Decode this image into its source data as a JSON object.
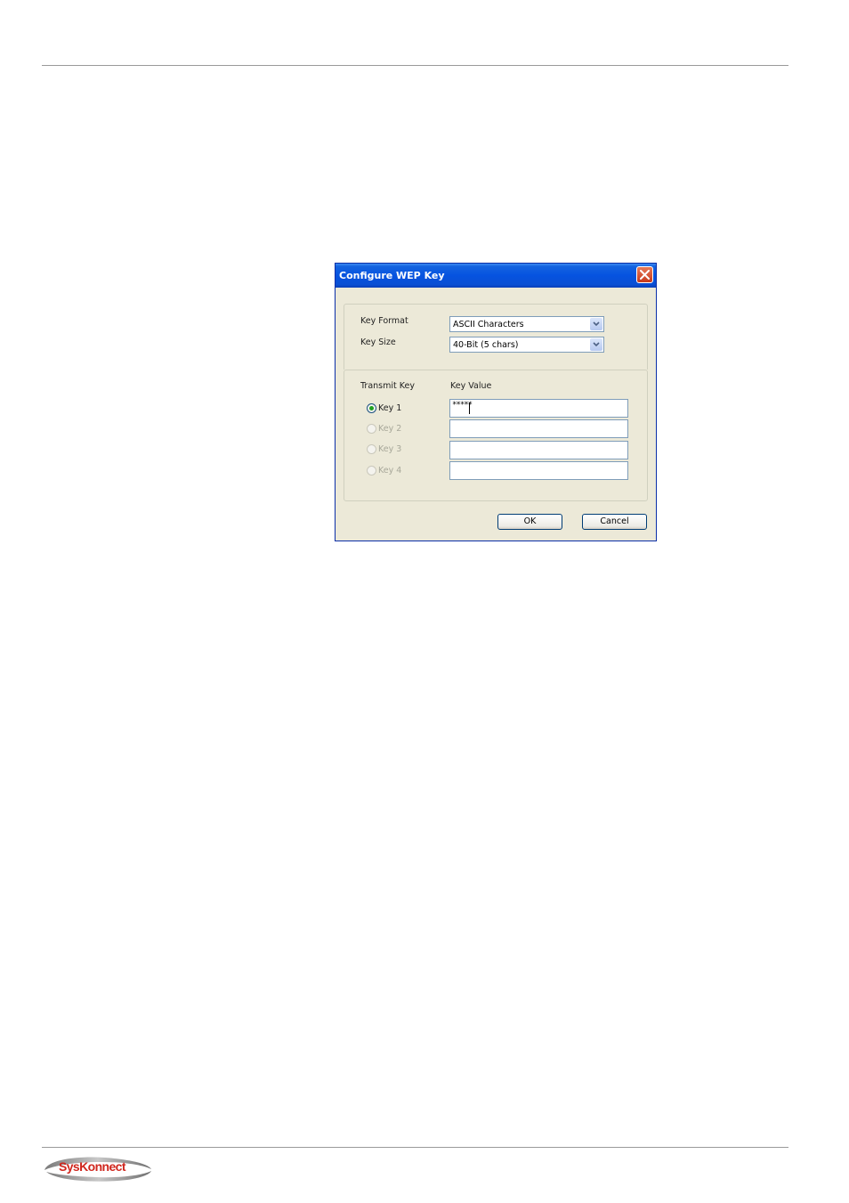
{
  "dialog": {
    "title": "Configure WEP Key",
    "key_format": {
      "label": "Key Format",
      "value": "ASCII Characters"
    },
    "key_size": {
      "label": "Key Size",
      "value": "40-Bit (5 chars)"
    },
    "transmit_key_header": "Transmit Key",
    "key_value_header": "Key Value",
    "keys": [
      {
        "label": "Key 1",
        "value": "*****",
        "selected": true,
        "enabled": true
      },
      {
        "label": "Key 2",
        "value": "",
        "selected": false,
        "enabled": false
      },
      {
        "label": "Key 3",
        "value": "",
        "selected": false,
        "enabled": false
      },
      {
        "label": "Key 4",
        "value": "",
        "selected": false,
        "enabled": false
      }
    ],
    "ok_label": "OK",
    "cancel_label": "Cancel"
  },
  "footer": {
    "logo_text": "SysKonnect"
  },
  "icons": {
    "close": "close-icon",
    "dropdown": "chevron-down-icon",
    "logo": "syskonnect-logo-icon"
  },
  "colors": {
    "titlebar": "#0653e0",
    "dialog_bg": "#ece9d8",
    "close_button": "#c7381b",
    "radio_selected": "#21a121"
  }
}
